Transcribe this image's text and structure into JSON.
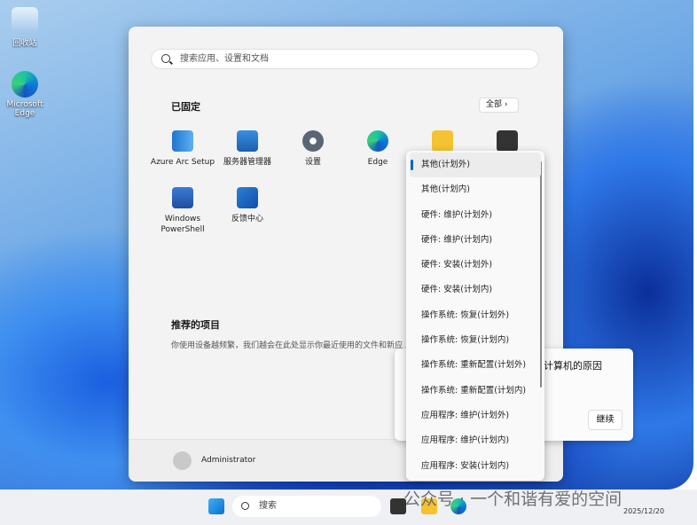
{
  "desktop": {
    "icons": [
      {
        "label": "回收站"
      },
      {
        "label": "Microsoft Edge"
      }
    ]
  },
  "start": {
    "search_placeholder": "搜索应用、设置和文档",
    "pinned_title": "已固定",
    "all_button": "全部 ›",
    "apps": [
      {
        "label": "Azure Arc Setup"
      },
      {
        "label": "服务器管理器"
      },
      {
        "label": "设置"
      },
      {
        "label": "Edge"
      },
      {
        "label": ""
      },
      {
        "label": ""
      },
      {
        "label": "Windows PowerShell"
      },
      {
        "label": "反馈中心"
      }
    ],
    "recommended_title": "推荐的项目",
    "recommended_text": "你使用设备越频繁，我们越会在此处显示你最近使用的文件和新应",
    "user": "Administrator"
  },
  "dialog": {
    "text": "计算机的原因",
    "continue_label": "继续"
  },
  "dropdown": {
    "selected": 0,
    "options": [
      "其他(计划外)",
      "其他(计划内)",
      "硬件: 维护(计划外)",
      "硬件: 维护(计划内)",
      "硬件: 安装(计划外)",
      "硬件: 安装(计划内)",
      "操作系统: 恢复(计划外)",
      "操作系统: 恢复(计划内)",
      "操作系统: 重新配置(计划外)",
      "操作系统: 重新配置(计划内)",
      "应用程序: 维护(计划外)",
      "应用程序: 维护(计划内)",
      "应用程序: 安装(计划内)"
    ]
  },
  "taskbar": {
    "search_label": "搜索",
    "date": "2025/12/20"
  },
  "watermark": "公众号 · 一个和谐有爱的空间"
}
